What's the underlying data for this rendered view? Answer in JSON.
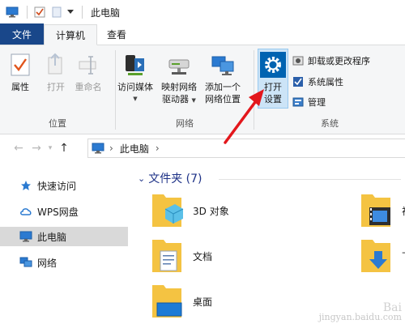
{
  "window": {
    "title": "此电脑"
  },
  "tabs": [
    {
      "label": "文件"
    },
    {
      "label": "计算机"
    },
    {
      "label": "查看"
    }
  ],
  "ribbon": {
    "location": {
      "label": "位置",
      "buttons": {
        "properties": "属性",
        "open": "打开",
        "rename": "重命名"
      }
    },
    "network": {
      "label": "网络",
      "buttons": {
        "media_line1": "访问媒体",
        "map_line1": "映射网络",
        "map_line2": "驱动器",
        "addloc_line1": "添加一个",
        "addloc_line2": "网络位置"
      }
    },
    "system": {
      "label": "系统",
      "open_line1": "打开",
      "open_line2": "设置",
      "uninstall": "卸载或更改程序",
      "sysprops": "系统属性",
      "manage": "管理"
    }
  },
  "address": {
    "crumb": "此电脑"
  },
  "navpane": {
    "items": [
      {
        "label": "快速访问"
      },
      {
        "label": "WPS网盘"
      },
      {
        "label": "此电脑"
      },
      {
        "label": "网络"
      }
    ]
  },
  "content": {
    "section_title": "文件夹 (7)",
    "folders": [
      {
        "label": "3D 对象"
      },
      {
        "label": "视"
      },
      {
        "label": "文档"
      },
      {
        "label": "下"
      },
      {
        "label": "桌面"
      }
    ]
  },
  "watermark": {
    "line1": "Bai",
    "line2": "jingyan.baidu.com"
  },
  "colors": {
    "file_tab": "#19478a",
    "accent": "#0063b1",
    "arrow": "#e3171c",
    "folder": "#f4c342"
  }
}
